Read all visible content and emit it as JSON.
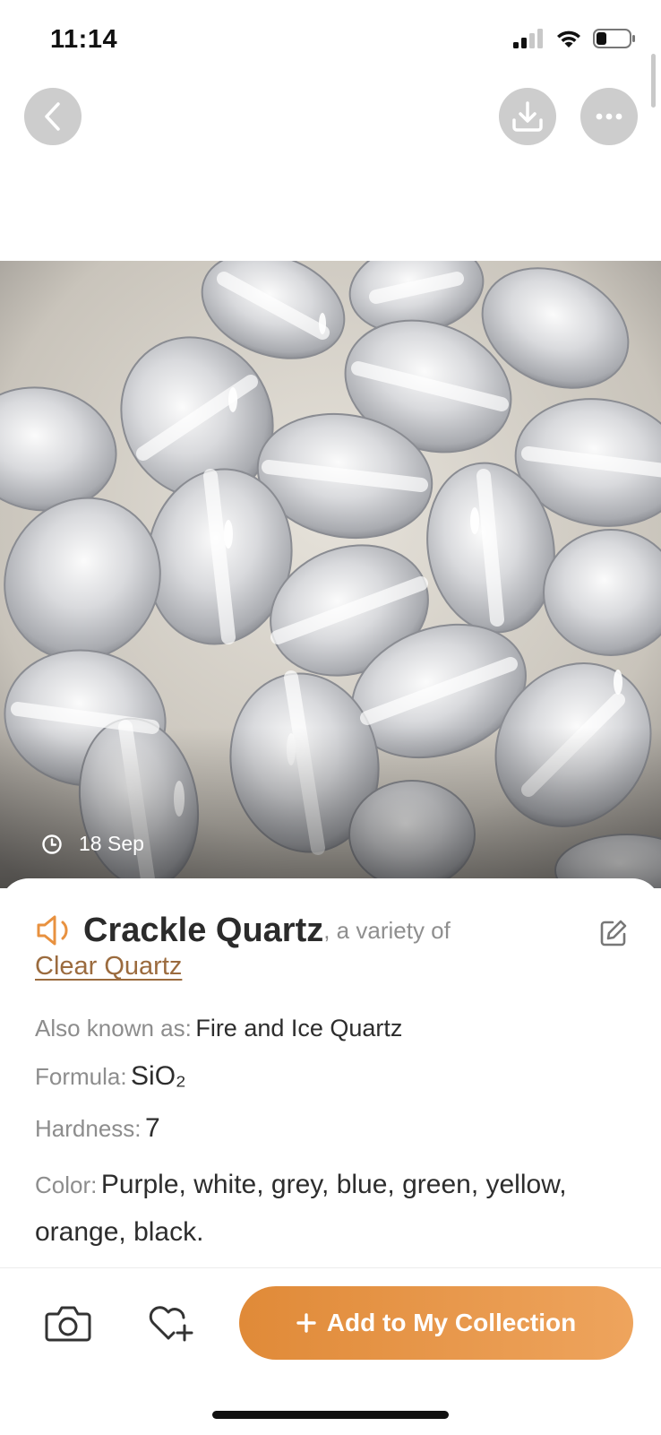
{
  "status_bar": {
    "time": "11:14"
  },
  "header": {
    "back_icon": "chevron-left-icon",
    "download_icon": "download-icon",
    "more_icon": "more-horizontal-icon"
  },
  "photo": {
    "date_icon": "clock-icon",
    "date": "18 Sep"
  },
  "stone": {
    "audio_icon": "speaker-icon",
    "name": "Crackle Quartz",
    "variety_text": ", a variety of",
    "parent": "Clear Quartz",
    "edit_icon": "edit-icon",
    "properties": {
      "aka_label": "Also known as:",
      "aka_value": "Fire and Ice Quartz",
      "formula_label": "Formula:",
      "formula_value": "SiO₂",
      "hardness_label": "Hardness:",
      "hardness_value": "7",
      "color_label": "Color:",
      "color_value": "Purple, white, grey, blue, green, yellow, orange, black."
    }
  },
  "bottom_bar": {
    "camera_icon": "camera-icon",
    "wishlist_icon": "heart-plus-icon",
    "add_label": "Add to My Collection",
    "add_icon": "plus-icon"
  },
  "colors": {
    "accent": "#e8913f",
    "link": "#9b6b3e",
    "label_gray": "#8d8d8d"
  }
}
